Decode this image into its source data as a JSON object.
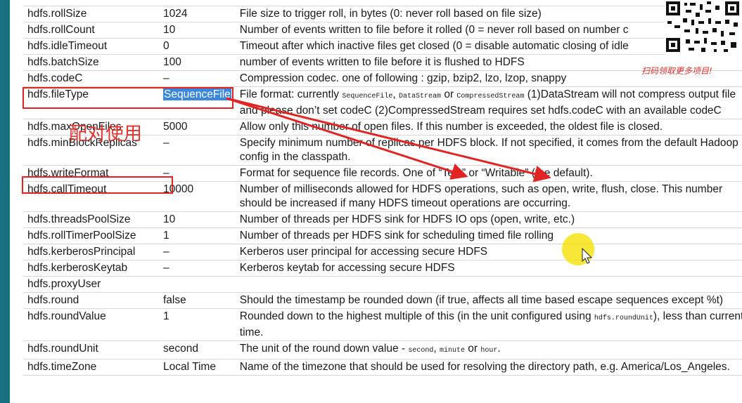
{
  "params": [
    {
      "name": "hdfs.rollSize",
      "def": "1024",
      "desc": "File size to trigger roll, in bytes (0: never roll based on file size)"
    },
    {
      "name": "hdfs.rollCount",
      "def": "10",
      "desc": "Number of events written to file before it rolled (0 = never roll based on number c"
    },
    {
      "name": "hdfs.idleTimeout",
      "def": "0",
      "desc": "Timeout after which inactive files get closed (0 = disable automatic closing of idle"
    },
    {
      "name": "hdfs.batchSize",
      "def": "100",
      "desc": "number of events written to file before it is flushed to HDFS"
    },
    {
      "name": "hdfs.codeC",
      "def": "–",
      "desc": "Compression codec. one of following : gzip, bzip2, lzo, lzop, snappy"
    },
    {
      "name": "hdfs.fileType",
      "def": "SequenceFile",
      "desc_a": "File format: currently ",
      "code_1": "SequenceFile",
      "sep_1": ", ",
      "code_2": "DataStream",
      "sep_2": " or ",
      "code_3": "CompressedStream",
      "desc_b": " (1)DataStream will not compress output file and please don’t set codeC (2)CompressedStream requires set hdfs.codeC with an available codeC"
    },
    {
      "name": "hdfs.maxOpenFiles",
      "def": "5000",
      "desc": "Allow only this number of open files. If this number is exceeded, the oldest file is closed."
    },
    {
      "name": "hdfs.minBlockReplicas",
      "def": "–",
      "desc": "Specify minimum number of replicas per HDFS block. If not specified, it comes from the default Hadoop config in the classpath."
    },
    {
      "name": "hdfs.writeFormat",
      "def": "–",
      "desc": "Format for sequence file records. One of “Text” or “Writable” (the default)."
    },
    {
      "name": "hdfs.callTimeout",
      "def": "10000",
      "desc": "Number of milliseconds allowed for HDFS operations, such as open, write, flush, close. This number should be increased if many HDFS timeout operations are occurring."
    },
    {
      "name": "hdfs.threadsPoolSize",
      "def": "10",
      "desc": "Number of threads per HDFS sink for HDFS IO ops (open, write, etc.)"
    },
    {
      "name": "hdfs.rollTimerPoolSize",
      "def": "1",
      "desc": "Number of threads per HDFS sink for scheduling timed file rolling"
    },
    {
      "name": "hdfs.kerberosPrincipal",
      "def": "–",
      "desc": "Kerberos user principal for accessing secure HDFS"
    },
    {
      "name": "hdfs.kerberosKeytab",
      "def": "–",
      "desc": "Kerberos keytab for accessing secure HDFS"
    },
    {
      "name": "hdfs.proxyUser",
      "def": "",
      "desc": ""
    },
    {
      "name": "hdfs.round",
      "def": "false",
      "desc": "Should the timestamp be rounded down (if true, affects all time based escape sequences except %t)"
    },
    {
      "name": "hdfs.roundValue",
      "def": "1",
      "desc_a": "Rounded down to the highest multiple of this (in the unit configured using ",
      "code_1": "hdfs.roundUnit",
      "desc_b": "), less than current time."
    },
    {
      "name": "hdfs.roundUnit",
      "def": "second",
      "desc_a": "The unit of the round down value - ",
      "code_1": "second",
      "sep_1": ", ",
      "code_2": "minute",
      "sep_2": " or ",
      "code_3": "hour",
      "desc_b": "."
    },
    {
      "name": "hdfs.timeZone",
      "def": "Local Time",
      "desc": "Name of the timezone that should be used for resolving the directory path, e.g. America/Los_Angeles."
    }
  ],
  "annotation": {
    "pair_note": "配对使用",
    "qr_caption": "扫码领取更多项目!"
  },
  "colors": {
    "annotation_red": "#e02424",
    "selection_blue": "#3a88de",
    "left_bar": "#17707f",
    "cursor_highlight": "#f5e100"
  }
}
